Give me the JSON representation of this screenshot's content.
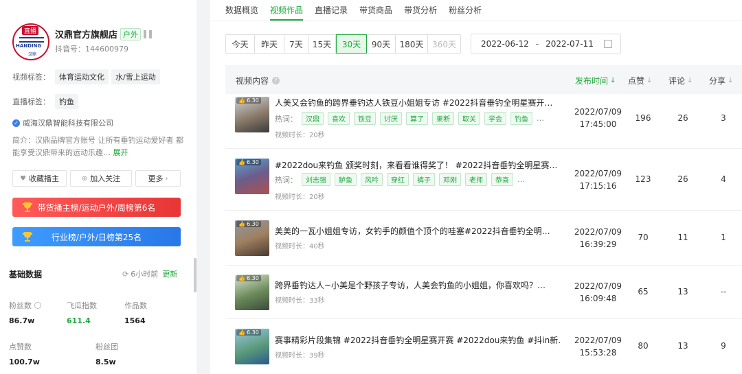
{
  "sidebar": {
    "avatar_live": "直播",
    "avatar_brand": "HANDING",
    "avatar_sub": "汉鼎",
    "shop_name": "汉鼎官方旗舰店",
    "category_tag": "户外",
    "douyin_id": "抖音号：144600979",
    "video_tags_label": "视频标签：",
    "video_tags": [
      "体育运动文化",
      "水/雪上运动"
    ],
    "live_tags_label": "直播标签：",
    "live_tags": [
      "钓鱼"
    ],
    "company": "威海汉鼎智能科技有限公司",
    "intro": "简介：汉鼎品牌官方账号 让所有垂钓运动爱好者 都能享受汉鼎带来的运动乐趣…",
    "expand": "展开",
    "actions": {
      "favorite": "收藏播主",
      "follow": "加入关注",
      "more": "更多"
    },
    "rank1": "带货播主榜/运动户外/周榜第6名",
    "rank2": "行业榜/户外/日榜第25名",
    "basic_title": "基础数据",
    "refresh_time": "6小时前",
    "refresh_btn": "更新",
    "stats": {
      "fans_label": "粉丝数",
      "fans": "86.7w",
      "feigua_label": "飞瓜指数",
      "feigua": "611.4",
      "works_label": "作品数",
      "works": "1564",
      "likes_label": "点赞数",
      "likes": "100.7w",
      "group_label": "粉丝团",
      "group": "8.5w"
    }
  },
  "tabs": [
    "数据概览",
    "视频作品",
    "直播记录",
    "带货商品",
    "带货分析",
    "粉丝分析"
  ],
  "ranges": [
    "今天",
    "昨天",
    "7天",
    "15天",
    "30天",
    "90天",
    "180天",
    "360天"
  ],
  "date_range": {
    "start": "2022-06-12",
    "sep": "-",
    "end": "2022-07-11"
  },
  "table": {
    "headers": {
      "content": "视频内容",
      "time": "发布时间",
      "likes": "点赞",
      "comments": "评论",
      "shares": "分享"
    },
    "hot_label": "热词：",
    "rows": [
      {
        "badge": "6.30",
        "title": "人美又会钓鱼的跨界垂钓达人铁豆小姐姐专访 #2022抖音垂钓全明星赛开…",
        "hot": [
          "汉鼎",
          "喜欢",
          "铁豆",
          "讨厌",
          "算了",
          "果断",
          "取关",
          "学会",
          "钓鱼"
        ],
        "more": "…",
        "duration": "视频时长：20秒",
        "date": "2022/07/09",
        "time": "17:45:00",
        "likes": "196",
        "comments": "26",
        "shares": "3"
      },
      {
        "badge": "6.30",
        "title": "#2022dou来钓鱼 颁奖时刻，来看看谁得奖了！ #2022抖音垂钓全明星赛…",
        "hot": [
          "刘志强",
          "鲈鱼",
          "风吟",
          "穿红",
          "裤子",
          "邓刚",
          "老师",
          "恭喜"
        ],
        "more": "…",
        "duration": "视频时长：20秒",
        "date": "2022/07/09",
        "time": "17:15:16",
        "likes": "123",
        "comments": "26",
        "shares": "4"
      },
      {
        "badge": "6.30",
        "title": "美美的一瓦小姐姐专访，女钓手的颜值个顶个的哇塞#2022抖音垂钓全明…",
        "hot": [],
        "duration": "视频时长：40秒",
        "date": "2022/07/09",
        "time": "16:39:29",
        "likes": "70",
        "comments": "11",
        "shares": "1"
      },
      {
        "badge": "6.30",
        "title": "跨界垂钓达人~小美是个野孩子专访，人美会钓鱼的小姐姐，你喜欢吗？…",
        "hot": [],
        "duration": "视频时长：33秒",
        "date": "2022/07/09",
        "time": "16:09:48",
        "likes": "65",
        "comments": "13",
        "shares": "--"
      },
      {
        "badge": "6.30",
        "title": "赛事精彩片段集锦 #2022抖音垂钓全明星赛开赛 #2022dou来钓鱼 #抖in新…",
        "hot": [],
        "duration": "视频时长：39秒",
        "date": "2022/07/09",
        "time": "15:53:28",
        "likes": "80",
        "comments": "13",
        "shares": "9"
      }
    ]
  },
  "colors": {
    "accent": "#22a93e",
    "rank_red": "#e83535",
    "rank_blue": "#2877e8"
  }
}
